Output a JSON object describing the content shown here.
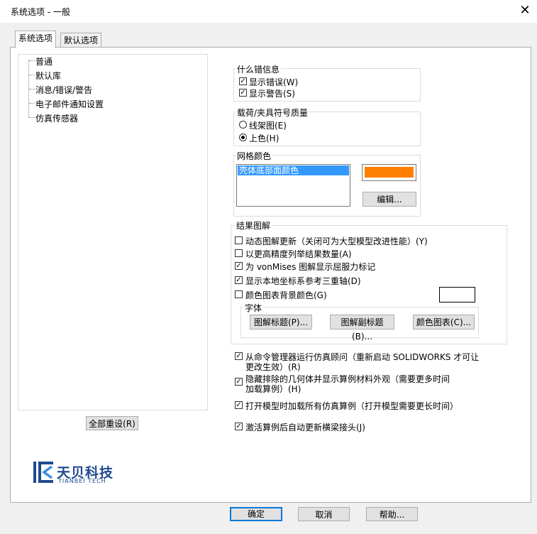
{
  "window": {
    "title": "系统选项 - 一般",
    "close_label": "✕"
  },
  "tabs": [
    {
      "label": "系统选项"
    },
    {
      "label": "默认选项"
    }
  ],
  "tree": {
    "items": [
      {
        "label": "普通"
      },
      {
        "label": "默认库"
      },
      {
        "label": "消息/错误/警告"
      },
      {
        "label": "电子邮件通知设置"
      },
      {
        "label": "仿真传感器"
      }
    ]
  },
  "reset_button": "全部重设(R)",
  "errors_group": {
    "title": "什么错信息",
    "show_errors": {
      "label": "显示错误(W)",
      "checked": true
    },
    "show_warnings": {
      "label": "显示警告(S)",
      "checked": true
    }
  },
  "load_group": {
    "title": "载荷/夹具符号质量",
    "wireframe": {
      "label": "线架图(E)",
      "selected": false
    },
    "shaded": {
      "label": "上色(H)",
      "selected": true
    }
  },
  "mesh_group": {
    "title": "网格颜色",
    "list_item": "壳体底部面颜色",
    "swatch_color": "#ff8000",
    "edit_button": "编辑..."
  },
  "results_group": {
    "title": "结果图解",
    "options": [
      {
        "label": "动态图解更新（关闭可为大型模型改进性能）(Y)",
        "checked": false
      },
      {
        "label": "以更高精度列举结果数量(A)",
        "checked": false
      },
      {
        "label": "为 vonMises 图解显示屈服力标记",
        "checked": true
      },
      {
        "label": "显示本地坐标系参考三重轴(D)",
        "checked": true
      },
      {
        "label": "颜色图表背景颜色(G)",
        "checked": false
      }
    ],
    "bg_color_swatch": "#ffffff",
    "font_group": {
      "title": "字体",
      "buttons": [
        "图解标题(P)...",
        "图解副标题(B)...",
        "颜色图表(C)..."
      ]
    }
  },
  "bottom_options": [
    {
      "line1": "从命令管理器运行仿真顾问（重新启动 SOLIDWORKS 才可让",
      "line2": "更改生效）(R)",
      "checked": true
    },
    {
      "line1": "隐藏排除的几何体并显示算例材料外观（需要更多时间",
      "line2": "加载算例）(H)",
      "checked": true
    },
    {
      "line1": "打开模型时加载所有仿真算例（打开模型需要更长时间）",
      "line2": "",
      "checked": true
    },
    {
      "line1": "激活算例后自动更新横梁接头(J)",
      "line2": "",
      "checked": true
    }
  ],
  "logo": {
    "name_cn": "天贝科技",
    "name_en": "TIANBEI TECH",
    "color": "#1d4a8f"
  },
  "footer": {
    "ok": "确定",
    "cancel": "取消",
    "help": "帮助..."
  },
  "colors": {
    "accent": "#3399ff",
    "selection": "#3399ff"
  }
}
